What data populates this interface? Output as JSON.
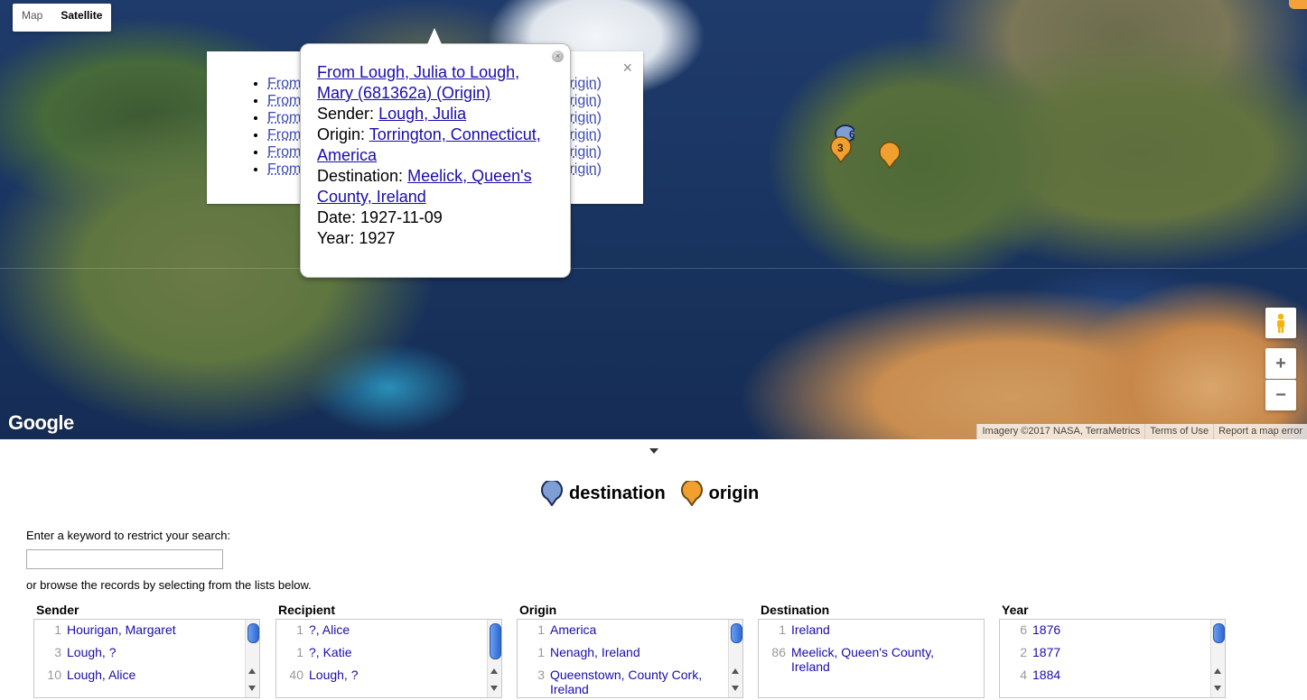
{
  "map": {
    "type_controls": {
      "map_label": "Map",
      "satellite_label": "Satellite",
      "selected": "Satellite"
    },
    "logo_text": "Google",
    "attribution": {
      "imagery": "Imagery ©2017 NASA, TerraMetrics",
      "terms": "Terms of Use",
      "report": "Report a map error"
    },
    "zoom_in_label": "+",
    "zoom_out_label": "−",
    "cluster_marker_labels": [
      "6",
      "3"
    ],
    "colors": {
      "destination": "#7f9ed6",
      "origin": "#f0a02e"
    }
  },
  "list_popup": {
    "close_label": "×",
    "rows": [
      {
        "left": "From",
        "right": "rigin)"
      },
      {
        "left": "From",
        "right": "rigin)"
      },
      {
        "left": "From",
        "right": "rigin)"
      },
      {
        "left": "From",
        "right": "rigin)"
      },
      {
        "left": "From",
        "right": "rigin)"
      },
      {
        "left": "From",
        "right": "rigin)"
      }
    ]
  },
  "detail_popup": {
    "title_link": "From Lough, Julia to Lough, Mary (681362a) (Origin)",
    "sender_label": "Sender:",
    "sender_value": "Lough, Julia",
    "origin_label": "Origin:",
    "origin_value": "Torrington, Connecticut, America",
    "destination_label": "Destination:",
    "destination_value": "Meelick, Queen's County, Ireland",
    "date_label": "Date:",
    "date_value": "1927-11-09",
    "year_label": "Year:",
    "year_value": "1927"
  },
  "legend": {
    "destination_label": "destination",
    "origin_label": "origin"
  },
  "search": {
    "prompt": "Enter a keyword to restrict your search:",
    "value": "",
    "browse_text": "or browse the records by selecting from the lists below."
  },
  "facets": {
    "sender": {
      "header": "Sender",
      "items": [
        {
          "count": "1",
          "value": "Hourigan, Margaret"
        },
        {
          "count": "3",
          "value": "Lough, ?"
        },
        {
          "count": "10",
          "value": "Lough, Alice"
        }
      ]
    },
    "recipient": {
      "header": "Recipient",
      "items": [
        {
          "count": "1",
          "value": "?, Alice"
        },
        {
          "count": "1",
          "value": "?, Katie"
        },
        {
          "count": "40",
          "value": "Lough, ?"
        }
      ]
    },
    "origin": {
      "header": "Origin",
      "items": [
        {
          "count": "1",
          "value": "America"
        },
        {
          "count": "1",
          "value": "Nenagh, Ireland"
        },
        {
          "count": "3",
          "value": "Queenstown, County Cork, Ireland"
        }
      ]
    },
    "destination": {
      "header": "Destination",
      "items": [
        {
          "count": "1",
          "value": "Ireland"
        },
        {
          "count": "86",
          "value": "Meelick, Queen's County, Ireland"
        }
      ]
    },
    "year": {
      "header": "Year",
      "items": [
        {
          "count": "6",
          "value": "1876"
        },
        {
          "count": "2",
          "value": "1877"
        },
        {
          "count": "4",
          "value": "1884"
        }
      ]
    }
  }
}
